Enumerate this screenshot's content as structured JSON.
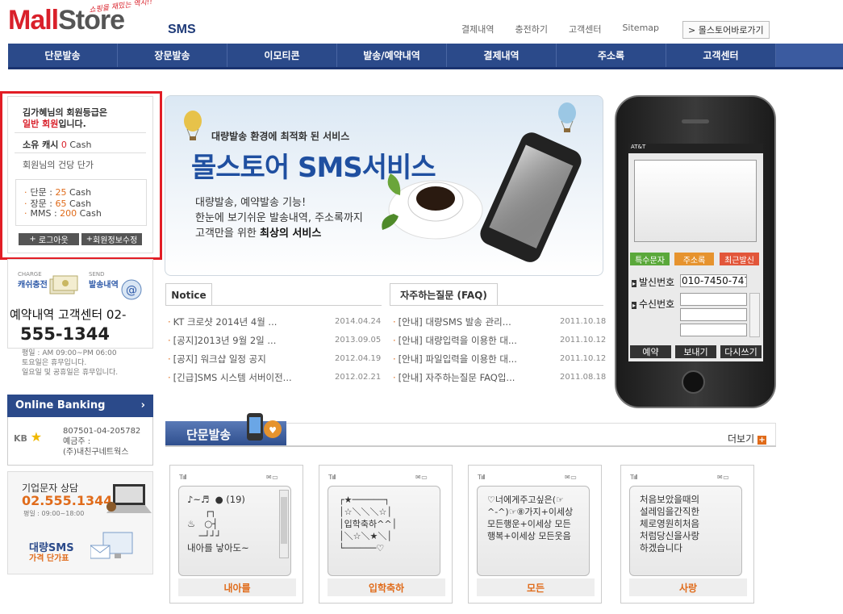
{
  "header": {
    "logo_mall": "Mall",
    "logo_store": "Store",
    "slogan": "쇼핑을 재밌는 역시!!",
    "sms_label": "SMS",
    "links": [
      "결제내역",
      "충전하기",
      "고객센터",
      "Sitemap"
    ],
    "goto_label": "> 몰스토어바로가기"
  },
  "nav": [
    "단문발송",
    "장문발송",
    "이모티콘",
    "발송/예약내역",
    "결제내역",
    "주소록",
    "고객센터"
  ],
  "member": {
    "line1": "김가혜님의 회원등급은",
    "grade": "일반 회원",
    "line1_end": "입니다.",
    "cash_label": "소유 캐시",
    "cash_value": "0",
    "cash_unit": "Cash",
    "rate_label": "회원님의 건당 단가",
    "prices": [
      {
        "label": "단문 :",
        "value": "25",
        "unit": "Cash"
      },
      {
        "label": "장문 :",
        "value": "65",
        "unit": "Cash"
      },
      {
        "label": "MMS :",
        "value": "200",
        "unit": "Cash"
      }
    ],
    "logout_label": "로그아웃",
    "edit_label": "회원정보수정"
  },
  "charge": {
    "charge_small": "CHARGE",
    "charge_label": "캐쉬충전",
    "send_small": "SEND",
    "send_label": "발송내역",
    "tel_line": "예약내역 고객센터 02-",
    "tel_number": "555-1344",
    "hours": [
      "평일 : AM 09:00~PM 06:00",
      "토요일은 휴무입니다.",
      "일요일 및 공휴일은 휴무입니다."
    ]
  },
  "bank": {
    "title": "Online Banking",
    "arrow": "›",
    "logo": "KB",
    "account": "807501-04-205782",
    "holder_label": "예금주 :",
    "holder": "(주)내친구네트웍스"
  },
  "corp": {
    "title": "기업문자 상담",
    "phone": "02.555.1344",
    "hours": "평일 : 09:00~18:00",
    "bulk": "대량SMS",
    "price": "가격 단가표"
  },
  "banner": {
    "tagline": "대량발송 환경에 최적화 된 서비스",
    "title": "몰스토어 SMS서비스",
    "line1": "대량발송, 예약발송 기능!",
    "line2": "한눈에 보기쉬운 발송내역, 주소록까지",
    "line3_pre": "고객만을 위한 ",
    "line3_bold": "최상의 서비스"
  },
  "notice": {
    "tab": "Notice",
    "items": [
      {
        "title": "KT 크로샷 2014년 4월 ...",
        "date": "2014.04.24"
      },
      {
        "title": "[공지]2013년 9월 2일 ...",
        "date": "2013.09.05"
      },
      {
        "title": "[공지] 워크샵 일정 공지",
        "date": "2012.04.19"
      },
      {
        "title": "[긴급]SMS 시스템 서버이전...",
        "date": "2012.02.21"
      }
    ]
  },
  "faq": {
    "tab": "자주하는질문 (FAQ)",
    "items": [
      {
        "title": "[안내] 대량SMS 발송 관리...",
        "date": "2011.10.18"
      },
      {
        "title": "[안내] 대량입력을 이용한 대...",
        "date": "2011.10.12"
      },
      {
        "title": "[안내] 파일입력을 이용한 대...",
        "date": "2011.10.12"
      },
      {
        "title": "[안내] 자주하는질문 FAQ입...",
        "date": "2011.08.18"
      }
    ]
  },
  "phone": {
    "carrier": "AT&T",
    "btn_special": "특수문자",
    "btn_address": "주소록",
    "btn_recent": "최근발신",
    "sender_label": "발신번호",
    "sender_value": "010-7450-747",
    "receiver_label": "수신번호",
    "btn_reserve": "예약",
    "btn_send": "보내기",
    "btn_rewrite": "다시쓰기"
  },
  "section": {
    "title": "단문발송",
    "more": "더보기"
  },
  "cards": [
    {
      "text": "♪~♬  ● (19)\n      ┌┐\n♨   ○┤\n    ─┘┘┘\n내아를 낳아도~",
      "label": "내아를"
    },
    {
      "text": "┌★──────┐\n│☆＼＼＼☆│\n│입학축하^^│\n│＼☆＼★＼│\n└──────♡",
      "label": "입학축하"
    },
    {
      "text": "♡너에게주고싶은(☞\n^-^)☞⑧가지+이세상\n모든행운+이세상 모든\n행복+이세상 모든웃음",
      "label": "모든"
    },
    {
      "text": "처음보았을때의\n설레임을간직한\n체로영원히처음\n처럼당신을사랑\n하겠습니다",
      "label": "사랑"
    }
  ],
  "colors": {
    "brand_red": "#d9202a",
    "nav_blue": "#2b4a8a",
    "accent_orange": "#e06b1a",
    "highlight_red": "#e21d25"
  }
}
